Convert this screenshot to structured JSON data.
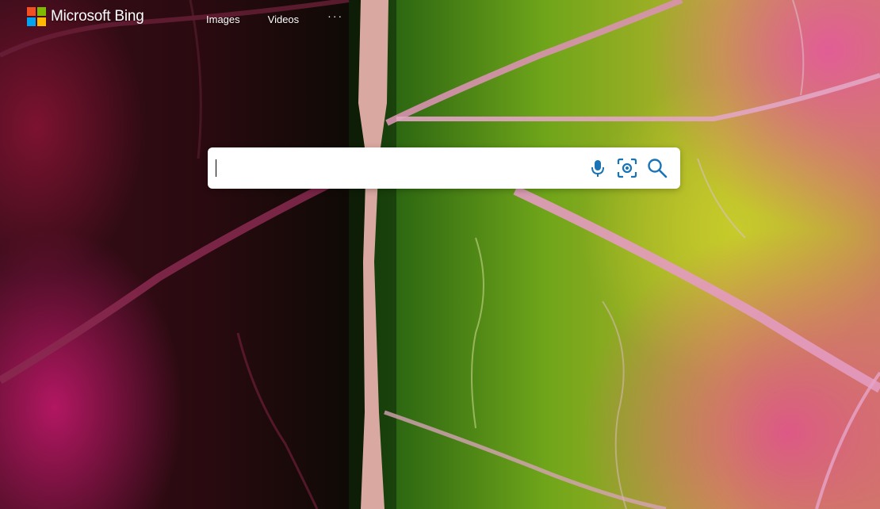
{
  "brand": {
    "name": "Microsoft Bing",
    "logo_colors": [
      "#f25022",
      "#7fba00",
      "#00a4ef",
      "#ffb900"
    ]
  },
  "nav": {
    "items": [
      {
        "label": "Images"
      },
      {
        "label": "Videos"
      }
    ],
    "more_label": "···"
  },
  "search": {
    "value": "",
    "placeholder": "",
    "icons": [
      "microphone-icon",
      "visual-search-icon",
      "search-icon"
    ],
    "icon_color": "#1a73b5"
  }
}
